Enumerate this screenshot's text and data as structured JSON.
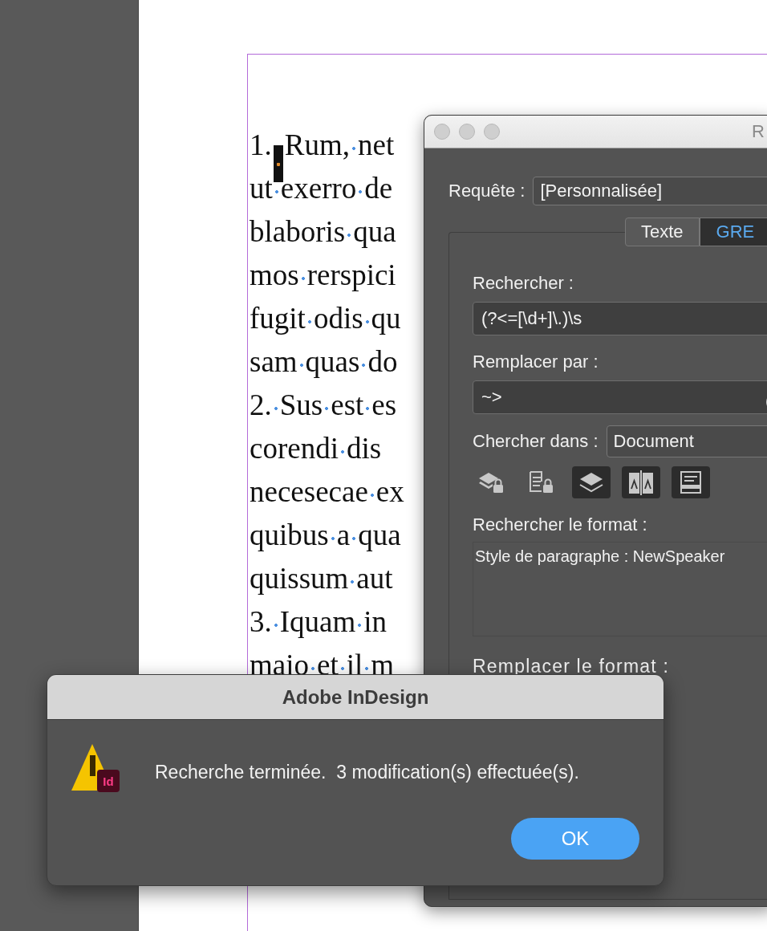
{
  "page": {
    "lines": [
      {
        "words": [
          "1.",
          "Rum,",
          "net"
        ],
        "selected": true
      },
      {
        "words": [
          "ut",
          "exerro",
          "de"
        ],
        "selected": false
      },
      {
        "words": [
          "blaboris",
          "qua"
        ],
        "selected": false
      },
      {
        "words": [
          "mos",
          "rerspici"
        ],
        "selected": false
      },
      {
        "words": [
          "fugit",
          "odis",
          "qu"
        ],
        "selected": false
      },
      {
        "words": [
          "sam",
          "quas",
          "do"
        ],
        "selected": false
      },
      {
        "words": [
          "2.",
          "Sus",
          "est",
          "es"
        ],
        "selected": false
      },
      {
        "words": [
          "corendi",
          "dis"
        ],
        "selected": false
      },
      {
        "words": [
          "necesecae",
          "ex"
        ],
        "selected": false
      },
      {
        "words": [
          "quibus",
          "a",
          "qua"
        ],
        "selected": false
      },
      {
        "words": [
          "quissum",
          "aut"
        ],
        "selected": false
      },
      {
        "words": [
          "3.",
          "Iquam",
          "in"
        ],
        "selected": false
      },
      {
        "words": [
          "maio",
          "et",
          "il",
          "m"
        ],
        "selected": false
      }
    ]
  },
  "find_window": {
    "title": "R",
    "query_label": "Requête :",
    "query_value": "[Personnalisée]",
    "tabs": [
      {
        "label": "Texte",
        "selected": false
      },
      {
        "label": "GRE",
        "selected": true
      }
    ],
    "find_label": "Rechercher :",
    "find_value": "(?<=[\\d+]\\.)\\s",
    "replace_label": "Remplacer par :",
    "replace_value": "~>",
    "search_in_label": "Chercher dans :",
    "search_in_value": "Document",
    "options": [
      {
        "kind": "locked-layers",
        "selected": false
      },
      {
        "kind": "locked-document",
        "selected": false
      },
      {
        "kind": "layers",
        "selected": true
      },
      {
        "kind": "spread",
        "selected": true
      },
      {
        "kind": "document",
        "selected": true
      }
    ],
    "find_format_label": "Rechercher le format :",
    "find_format_value": "Style de paragraphe : NewSpeaker",
    "replace_format_label": "Remplacer le format :"
  },
  "alert": {
    "title": "Adobe InDesign",
    "badge": "Id",
    "message": "Recherche terminée.  3 modification(s) effectuée(s).",
    "button": "OK"
  }
}
